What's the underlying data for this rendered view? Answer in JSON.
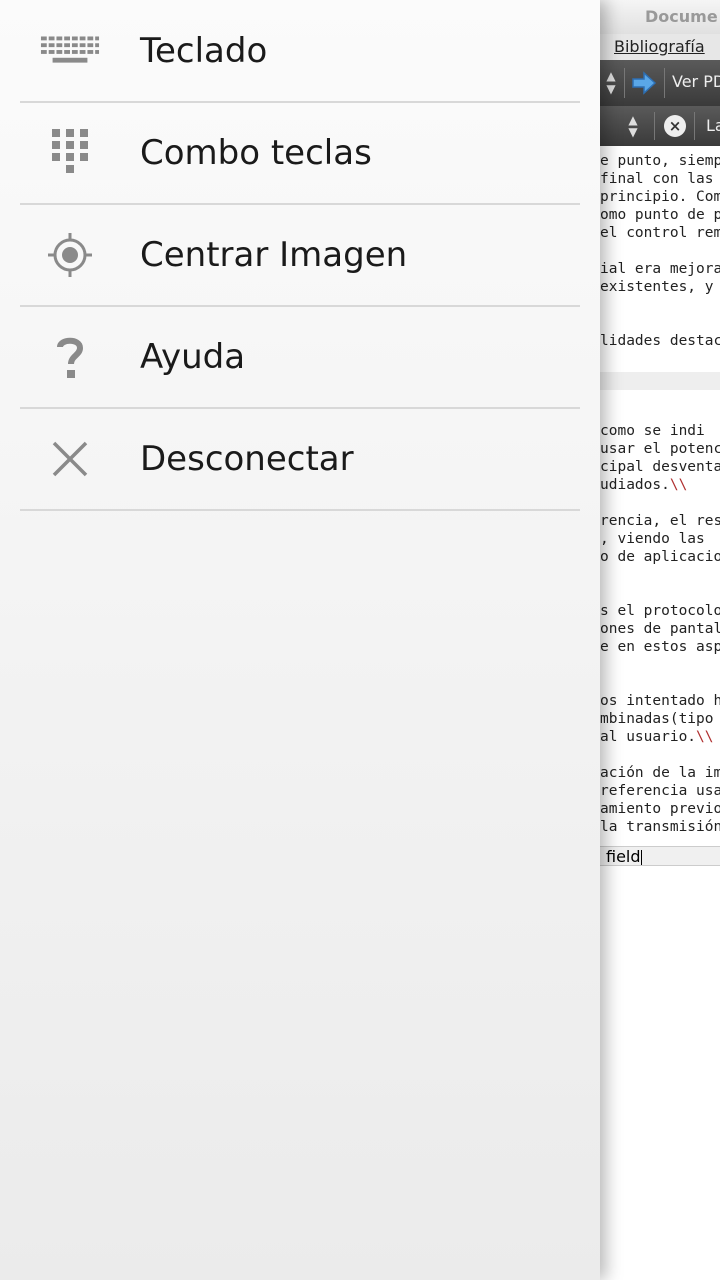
{
  "drawer": {
    "items": [
      {
        "label": "Teclado",
        "icon": "keyboard-icon"
      },
      {
        "label": "Combo teclas",
        "icon": "keypad-icon"
      },
      {
        "label": "Centrar Imagen",
        "icon": "locate-target-icon"
      },
      {
        "label": "Ayuda",
        "icon": "help-icon"
      },
      {
        "label": "Desconectar",
        "icon": "close-icon"
      }
    ]
  },
  "remote": {
    "window_title": "Docume",
    "menu_bibliografia": "Bibliografía",
    "toolbar_view_button": "Ver PD",
    "toolbar2_label": "La",
    "code_lines": [
      "e punto, siemp",
      "final con las",
      "principio. Com",
      "omo punto de p",
      "el control rem",
      "",
      "ial era mejora",
      "existentes, y",
      "",
      "",
      "lidades destac",
      "",
      "",
      "",
      "",
      " como se indi",
      "usar el potenc",
      "cipal desventa",
      "udiados.",
      "",
      "rencia, el res",
      ", viendo las",
      "o de aplicacio",
      "",
      "",
      "s el protocolo",
      "ones de pantal",
      "e en estos asp",
      "",
      "",
      "os intentado h",
      "mbinadas(tipo",
      "al usuario.",
      "",
      "ación de la im",
      "referencia usa",
      "amiento previo",
      "la transmisión"
    ],
    "line_suffix": "\\\\",
    "field_text": "field"
  }
}
